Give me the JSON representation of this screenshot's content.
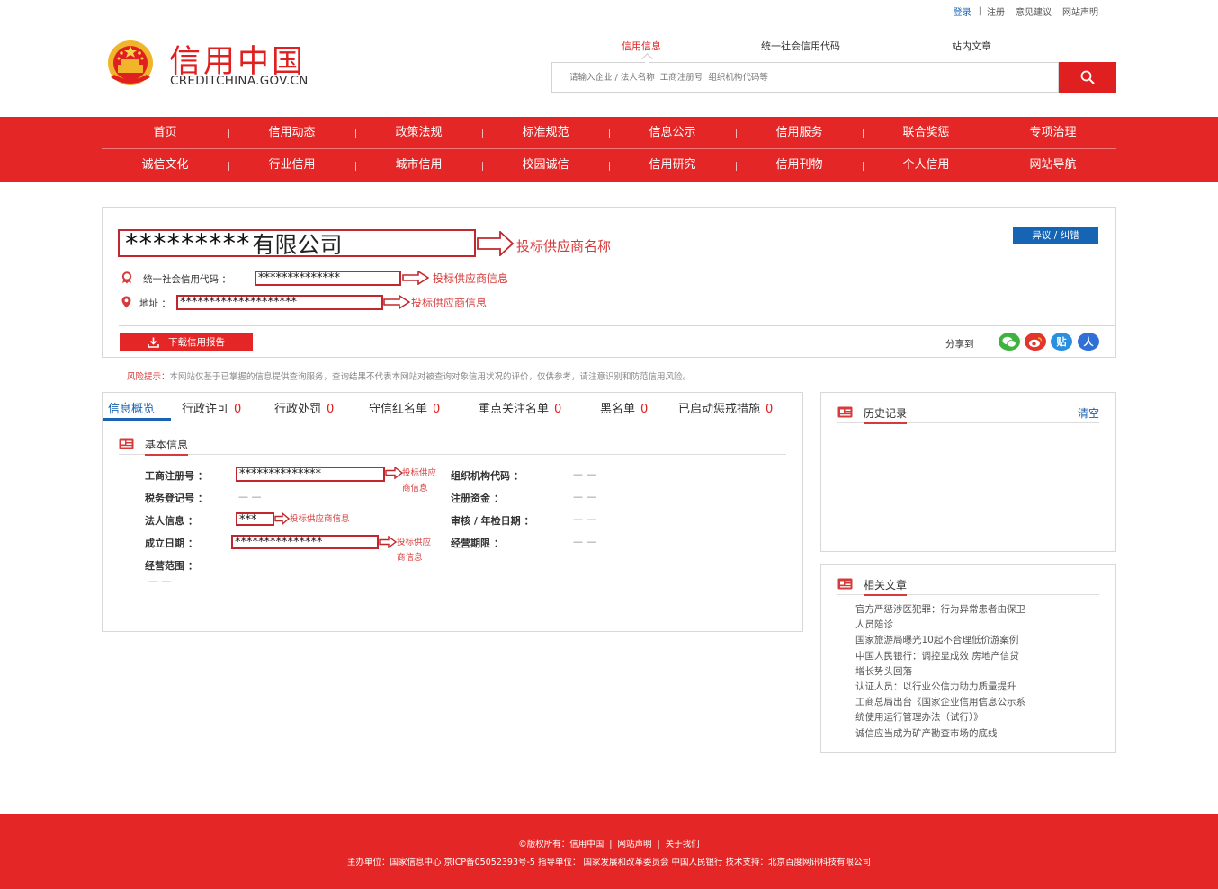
{
  "top_links": {
    "login": "登录",
    "separator": "|",
    "register": "注册",
    "feedback": "意见建议",
    "statement": "网站声明"
  },
  "logo": {
    "title": "信用中国",
    "domain": "CREDITCHINA.GOV.CN"
  },
  "search": {
    "tabs": [
      "信用信息",
      "统一社会信用代码",
      "站内文章"
    ],
    "placeholder": "请输入企业 / 法人名称  工商注册号  组织机构代码等"
  },
  "nav": {
    "row1": [
      "首页",
      "信用动态",
      "政策法规",
      "标准规范",
      "信息公示",
      "信用服务",
      "联合奖惩",
      "专项治理"
    ],
    "row2": [
      "诚信文化",
      "行业信用",
      "城市信用",
      "校园诚信",
      "信用研究",
      "信用刊物",
      "个人信用",
      "网站导航"
    ]
  },
  "company": {
    "name_mask": "*********",
    "name_suffix": "有限公司",
    "name_note": "投标供应商名称",
    "dispute_button": "异议 / 纠错",
    "credit_code_label": "统一社会信用代码 ：",
    "credit_code_value": "**************",
    "credit_code_note": "投标供应商信息",
    "address_label": "地址 ：",
    "address_value": "********************",
    "address_note": "投标供应商信息",
    "download_button": "下载信用报告",
    "share_label": "分享到",
    "share_icons": [
      "wechat-icon",
      "weibo-icon",
      "tieba-icon",
      "renren-icon"
    ],
    "share_tieba_glyph": "贴",
    "share_renren_glyph": "人"
  },
  "risk": {
    "label": "风险提示：",
    "text": "本网站仅基于已掌握的信息提供查询服务，查询结果不代表本网站对被查询对象信用状况的评价，仅供参考，请注意识别和防范信用风险。"
  },
  "info_tabs": [
    {
      "label": "信息概览",
      "count": ""
    },
    {
      "label": "行政许可",
      "count": "0"
    },
    {
      "label": "行政处罚",
      "count": "0"
    },
    {
      "label": "守信红名单",
      "count": "0"
    },
    {
      "label": "重点关注名单",
      "count": "0"
    },
    {
      "label": "黑名单",
      "count": "0"
    },
    {
      "label": "已启动惩戒措施",
      "count": "0"
    }
  ],
  "basic_info": {
    "title": "基本信息",
    "reg_no_label": "工商注册号 ：",
    "reg_no_value": "**************",
    "reg_no_note_1": "投标供应",
    "reg_no_note_2": "商信息",
    "org_code_label": "组织机构代码 ：",
    "org_code_value": "— —",
    "tax_label": "税务登记号 ：",
    "tax_value": "— —",
    "capital_label": "注册资金 ：",
    "capital_value": "— —",
    "legal_label": "法人信息 ：",
    "legal_value": "***",
    "legal_note": "投标供应商信息",
    "audit_label": "审核 / 年检日期 ：",
    "audit_value": "— —",
    "founded_label": "成立日期 ：",
    "founded_value": "***************",
    "founded_note_1": "投标供应",
    "founded_note_2": "商信息",
    "term_label": "经营期限 ：",
    "term_value": "— —",
    "scope_label": "经营范围 ：",
    "scope_value": "— —"
  },
  "history": {
    "title": "历史记录",
    "clear": "清空"
  },
  "related": {
    "title": "相关文章",
    "articles": [
      "官方严惩涉医犯罪：行为异常患者由保卫",
      "人员陪诊",
      "国家旅游局曝光10起不合理低价游案例",
      "中国人民银行：调控显成效 房地产信贷",
      "增长势头回落",
      "认证人员：以行业公信力助力质量提升",
      "工商总局出台《国家企业信用信息公示系",
      "统使用运行管理办法（试行）》",
      "诚信应当成为矿产勘查市场的底线"
    ]
  },
  "footer": {
    "copyright": "©版权所有：信用中国",
    "sep": "|",
    "statement": "网站声明",
    "about": "关于我们",
    "line2": "主办单位：国家信息中心  京ICP备05052393号-5  指导单位： 国家发展和改革委员会  中国人民银行  技术支持：北京百度网讯科技有限公司"
  },
  "colors": {
    "brand_red": "#e42726",
    "link_blue": "#1a63b0",
    "annotation_red": "#c0282d"
  }
}
